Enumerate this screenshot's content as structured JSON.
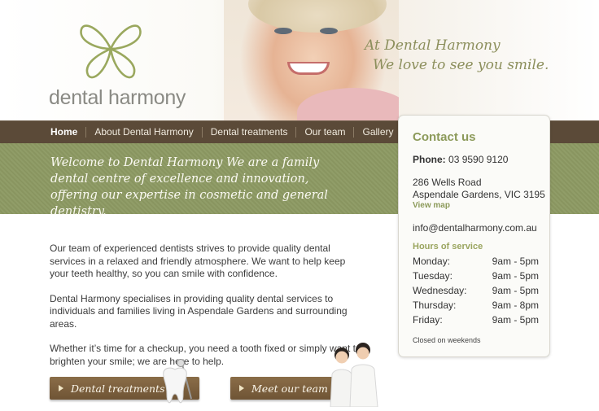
{
  "header": {
    "logo_text": "dental harmony",
    "tagline_line1": "At Dental Harmony",
    "tagline_line2": "We love to see you smile."
  },
  "nav": {
    "items": [
      {
        "label": "Home"
      },
      {
        "label": "About Dental Harmony"
      },
      {
        "label": "Dental treatments"
      },
      {
        "label": "Our team"
      },
      {
        "label": "Gallery"
      }
    ]
  },
  "welcome": {
    "text": "Welcome to Dental Harmony We are a family dental centre of excellence and innovation, offering our expertise in cosmetic and general dentistry."
  },
  "content": {
    "paragraphs": [
      "Our team of experienced dentists strives to provide quality dental services in a relaxed and friendly atmosphere. We want to help keep your teeth healthy, so you can smile with confidence.",
      "Dental Harmony specialises in providing quality dental services to individuals and families living in Aspendale Gardens and surrounding areas.",
      "Whether it’s time for a checkup, you need a tooth fixed or simply want to brighten your smile; we are here to help."
    ]
  },
  "buttons": {
    "treatments": "Dental treatments",
    "team": "Meet our team"
  },
  "contact": {
    "title": "Contact us",
    "phone_label": "Phone:",
    "phone_value": "03 9590 9120",
    "address_line1": "286 Wells Road",
    "address_line2": "Aspendale Gardens, VIC 3195",
    "view_map": "View map",
    "email": "info@dentalharmony.com.au",
    "hours_title": "Hours of service",
    "hours": [
      {
        "day": "Monday:",
        "time": "9am - 5pm"
      },
      {
        "day": "Tuesday:",
        "time": "9am - 5pm"
      },
      {
        "day": "Wednesday:",
        "time": "9am - 5pm"
      },
      {
        "day": "Thursday:",
        "time": "9am - 8pm"
      },
      {
        "day": "Friday:",
        "time": "9am - 5pm"
      }
    ],
    "closed_note": "Closed on weekends"
  },
  "colors": {
    "brand_green": "#8d9a63",
    "nav_brown": "#5b4a38",
    "button_brown": "#7a5e3c"
  }
}
